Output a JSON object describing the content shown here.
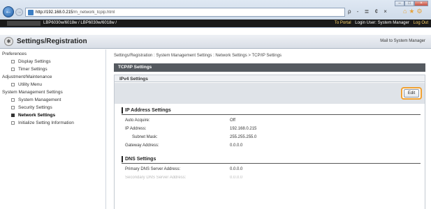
{
  "browser": {
    "url_prefix": "http://192.168.0.215",
    "url_rest": "/m_network_tcpip.html",
    "addr_tools": "ρ - ≣ ¢ ×",
    "window_min": "–",
    "window_max": "□",
    "window_close": "×"
  },
  "appbar": {
    "device": "LBP6030w/6018w / LBP6030w/6018w /",
    "portal": "To Portal",
    "login_user": "Login User: System Manager",
    "logout": "Log Out"
  },
  "header": {
    "title": "Settings/Registration",
    "mail_link": "Mail to System Manager"
  },
  "sidebar": {
    "preferences": "Preferences",
    "display_settings": "Display Settings",
    "timer_settings": "Timer Settings",
    "adjustment": "Adjustment/Maintenance",
    "utility_menu": "Utility Menu",
    "system_mgmt_settings": "System Management Settings",
    "system_management": "System Management",
    "security_settings": "Security Settings",
    "network_settings": "Network Settings",
    "initialize": "Initialize Setting Information"
  },
  "main": {
    "breadcrumb": "Settings/Registration : System Management Settings : Network Settings > TCP/IP Settings",
    "page_title": "TCP/IP Settings",
    "panel_title": "IPv4 Settings",
    "edit_label": "Edit",
    "ip_section": {
      "title": "IP Address Settings",
      "auto_acquire_label": "Auto Acquire:",
      "auto_acquire_value": "Off",
      "ip_label": "IP Address:",
      "ip_value": "192.168.0.215",
      "subnet_label": "Subnet Mask:",
      "subnet_value": "255.255.255.0",
      "gateway_label": "Gateway Address:",
      "gateway_value": "0.0.0.0"
    },
    "dns_section": {
      "title": "DNS Settings",
      "primary_label": "Primary DNS Server Address:",
      "primary_value": "0.0.0.0",
      "secondary_label": "Secondary DNS Server Address:",
      "secondary_value": "0.0.0.0"
    }
  },
  "colors": {
    "highlight": "#f0a030",
    "appbar": "#1a1a1a",
    "page_head": "#555a60"
  }
}
